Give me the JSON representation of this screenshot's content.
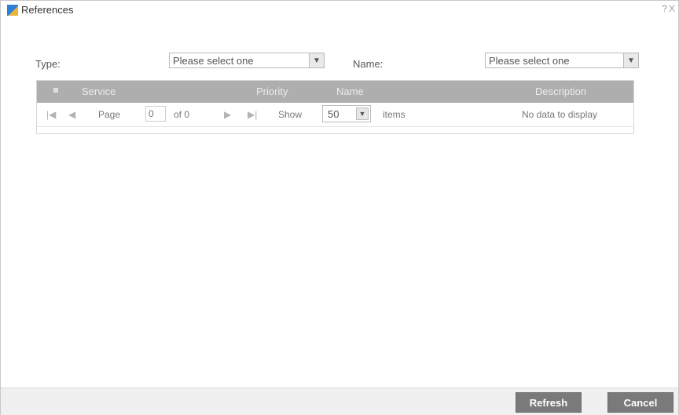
{
  "window": {
    "title": "References",
    "controls": [
      "?",
      "X"
    ]
  },
  "filters": {
    "type_label": "Type:",
    "type_value": "Please select one",
    "name_label": "Name:",
    "name_value": "Please select one"
  },
  "grid": {
    "columns": [
      "Service",
      "Priority",
      "Name",
      "Description"
    ],
    "pager": {
      "first": "|◀",
      "prev": "◀",
      "page_label": "Page",
      "page_value": "0",
      "of_label": "of 0",
      "next": "▶",
      "last": "▶|",
      "show_label": "Show",
      "show_value": "50",
      "items_label": "items",
      "status": "No data to display"
    }
  },
  "footer": {
    "refresh_label": "Refresh",
    "cancel_label": "Cancel"
  }
}
